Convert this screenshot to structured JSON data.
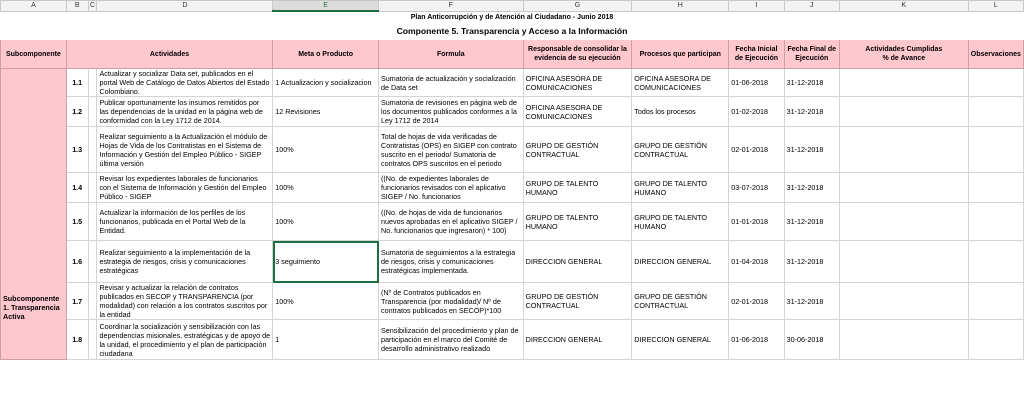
{
  "columns": [
    "A",
    "B",
    "C",
    "D",
    "E",
    "F",
    "G",
    "H",
    "I",
    "J",
    "K",
    "L"
  ],
  "selected_column": "E",
  "title": "Plan Anticorrupción y de Atención al Ciudadano - Junio 2018",
  "subtitle": "Componente 5. Transparencia y Acceso a la Información",
  "headers": {
    "subcomponente": "Subcomponente",
    "actividades": "Actividades",
    "meta": "Meta o Producto",
    "formula": "Formula",
    "responsable": "Responsable de consolidar la evidencia de su ejecución",
    "procesos": "Procesos que participan",
    "fecha_inicial": "Fecha Inicial de Ejecución",
    "fecha_final": "Fecha Final de Ejecución",
    "cumplidas": "Actividades Cumplidas\n% de Avance",
    "observaciones": "Observaciones"
  },
  "subcomponent_label": "Subcomponente 1. Transparencia Activa",
  "rows": [
    {
      "num": "1.1",
      "actividad": "Actualizar y socializar Data set, publicados en el portal Web de Catálogo de Datos Abiertos del Estado Colombiano.",
      "meta": "1 Actualizacion y socializacion",
      "formula": "Sumatoria de actualización y socialización de Data set",
      "responsable": "OFICINA ASESORA DE COMUNICACIONES",
      "procesos": "OFICINA ASESORA DE COMUNICACIONES",
      "inicio": "01-06-2018",
      "fin": "31-12-2018"
    },
    {
      "num": "1.2",
      "actividad": "Publicar oportunamente los insumos remitidos por las dependencias de la unidad en la página web de conformidad con la Ley 1712 de 2014.",
      "meta": "12 Revisiones",
      "formula": "Sumatoria de revisiones en página web de los documentos publicados conformes a la Ley 1712 de 2014",
      "responsable": "OFICINA ASESORA DE COMUNICACIONES",
      "procesos": "Todos los procesos",
      "inicio": "01-02-2018",
      "fin": "31-12-2018"
    },
    {
      "num": "1.3",
      "actividad": "Realizar seguimiento a la Actualización el módulo de Hojas de Vida de los Contratistas en el Sistema de Información y Gestión del Empleo Público - SIGEP última versión",
      "meta": "100%",
      "formula": "Total de hojas de vida verificadas de Contratistas (OPS) en SIGEP con contrato suscrito en el periodo/ Sumatoria de contratos OPS suscritos en el periodo",
      "responsable": "GRUPO DE GESTIÓN CONTRACTUAL",
      "procesos": "GRUPO DE GESTIÓN CONTRACTUAL",
      "inicio": "02-01-2018",
      "fin": "31-12-2018"
    },
    {
      "num": "1.4",
      "actividad": "Revisar los expedientes laborales de funcionarios con el Sistema de Información y Gestión del Empleo Público - SIGEP",
      "meta": "100%",
      "formula": "((No. de expedientes laborales de funcionarios revisados con el aplicativo SIGEP / No. funcionarios",
      "responsable": "GRUPO DE TALENTO HUMANO",
      "procesos": "GRUPO DE TALENTO HUMANO",
      "inicio": "03-07-2018",
      "fin": "31-12-2018"
    },
    {
      "num": "1.5",
      "actividad": "Actualizar la información de los perfiles de los funcionarios, publicada en el Portal Web de la Entidad.",
      "meta": "100%",
      "formula": "((No. de hojas de vida de funcionarios nuevos aprobadas en el aplicativo SIGEP / No. funcionarios que ingresaron) * 100)",
      "responsable": "GRUPO DE TALENTO HUMANO",
      "procesos": "GRUPO DE TALENTO HUMANO",
      "inicio": "01-01-2018",
      "fin": "31-12-2018"
    },
    {
      "num": "1.6",
      "actividad": "Realizar seguimiento a la implementación de la estrategia de riesgos, crisis y comunicaciones estratégicas",
      "meta": "3 seguimiento",
      "formula": "Sumatoria de seguimientos a la estrategia de riesgos, crisis y comunicaciones estratégicas implementada.",
      "responsable": "DIRECCION GENERAL",
      "procesos": "DIRECCION GENERAL",
      "inicio": "01-04-2018",
      "fin": "31-12-2018"
    },
    {
      "num": "1.7",
      "actividad": "Revisar y actualizar la relación de contratos publicados en SECOP y TRANSPARENCIA (por modalidad) con relación a los contratos suscritos por la entidad",
      "meta": "100%",
      "formula": "(Nº de Contratos publicados en Transparencia (por modalidad)/ Nº de contratos publicados en SECOP)*100",
      "responsable": "GRUPO DE GESTIÓN CONTRACTUAL",
      "procesos": "GRUPO DE GESTIÓN CONTRACTUAL",
      "inicio": "02-01-2018",
      "fin": "31-12-2018"
    },
    {
      "num": "1.8",
      "actividad": "Coordinar la socialización y sensibilización con las dependencias misionales, estratégicas y de apoyo de la unidad, el procedimiento y el plan de participación ciudadana",
      "meta": "1",
      "formula": "Sensibilización del procedimiento y plan de participación en el marco del Comité de desarrollo administrativo realizado",
      "responsable": "DIRECCION GENERAL",
      "procesos": "DIRECCION GENERAL",
      "inicio": "01-06-2018",
      "fin": "30-06-2018"
    }
  ]
}
